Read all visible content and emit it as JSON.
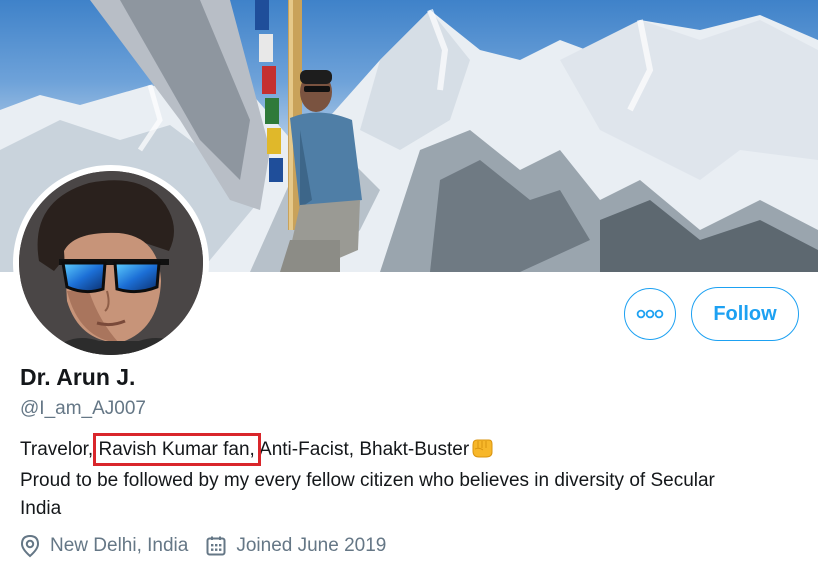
{
  "banner": {
    "icon": "mountain-photo"
  },
  "avatar": {
    "icon": "profile-photo"
  },
  "actions": {
    "more_icon": "more-dots-icon",
    "follow_label": "Follow",
    "accent_color": "#1da1f2"
  },
  "profile": {
    "display_name": "Dr. Arun J.",
    "handle": "@I_am_AJ007",
    "bio": {
      "part1": "Travelor, ",
      "highlight": "Ravish Kumar fan,",
      "part2": " Anti-Facist, Bhakt-Buster",
      "emoji": "fist-emoji",
      "line2": "Proud to be followed by my every fellow citizen who believes in diversity of Secular",
      "line3": "India"
    },
    "location": "New Delhi, India",
    "joined": "Joined June 2019"
  },
  "colors": {
    "text_primary": "#14171a",
    "text_secondary": "#657786",
    "highlight_box": "#d9262b"
  }
}
